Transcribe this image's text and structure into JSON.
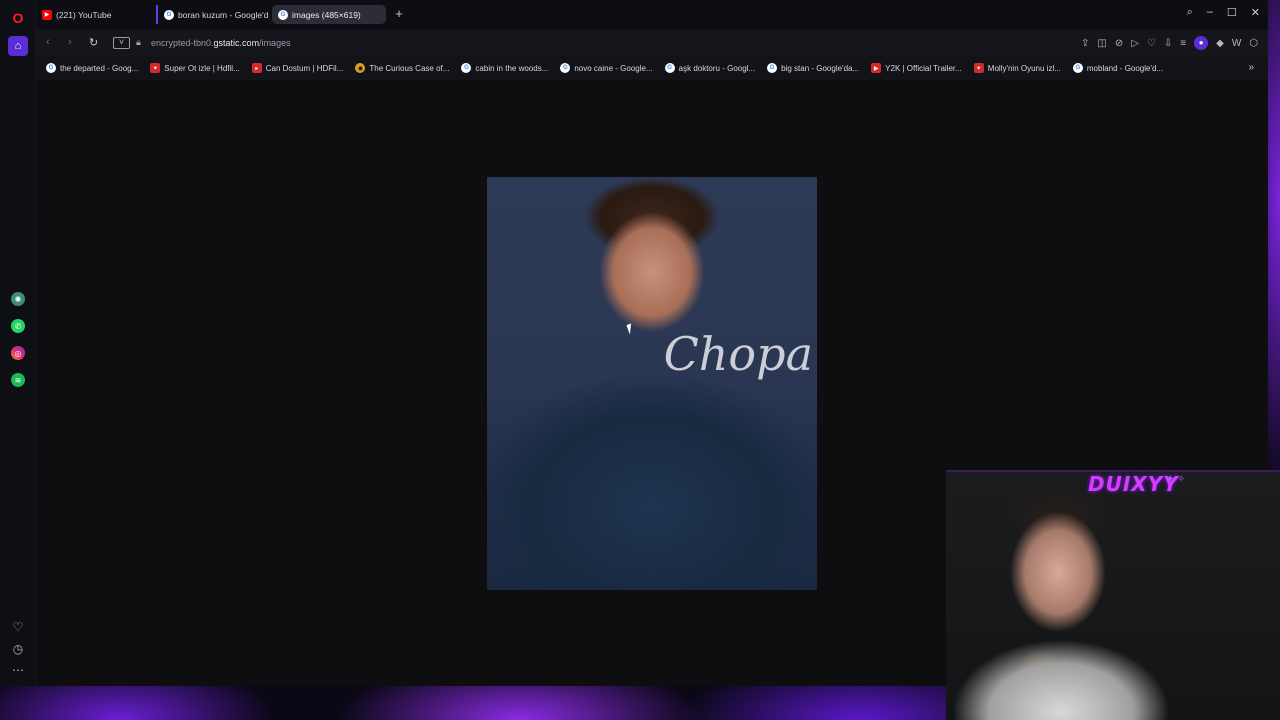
{
  "tabs": [
    {
      "label": "(221) YouTube",
      "icon": "youtube-icon"
    },
    {
      "label": "boran kuzum - Google'da",
      "icon": "google-icon"
    },
    {
      "label": "images (485×619)",
      "icon": "google-icon"
    }
  ],
  "address": {
    "vpn_label": "V",
    "url_prefix": "encrypted-tbn0.",
    "url_host": "gstatic.com",
    "url_path": "/images"
  },
  "bookmarks": [
    {
      "label": "the departed - Goog...",
      "icon": "google-icon"
    },
    {
      "label": "Super Ot izle | Hdfil...",
      "icon": "hdfilm-icon"
    },
    {
      "label": "Can Dostum | HDFil...",
      "icon": "hdfilm-icon"
    },
    {
      "label": "The Curious Case of...",
      "icon": "site-icon"
    },
    {
      "label": "cabin in the woods...",
      "icon": "google-icon"
    },
    {
      "label": "novo caine - Google...",
      "icon": "google-icon"
    },
    {
      "label": "aşk doktoru - Googl...",
      "icon": "google-icon"
    },
    {
      "label": "big stan - Google'da...",
      "icon": "google-icon"
    },
    {
      "label": "Y2K | Official Trailer...",
      "icon": "youtube-icon"
    },
    {
      "label": "Molly'nin Oyunu izl...",
      "icon": "hdfilm-icon"
    },
    {
      "label": "mobland - Google'd...",
      "icon": "google-icon"
    }
  ],
  "photo": {
    "script_text": "Chopa"
  },
  "webcam": {
    "streamer_name": "DUIXYY"
  },
  "colors": {
    "accent": "#5a2dd6",
    "overlay_name": "#d63bff"
  }
}
